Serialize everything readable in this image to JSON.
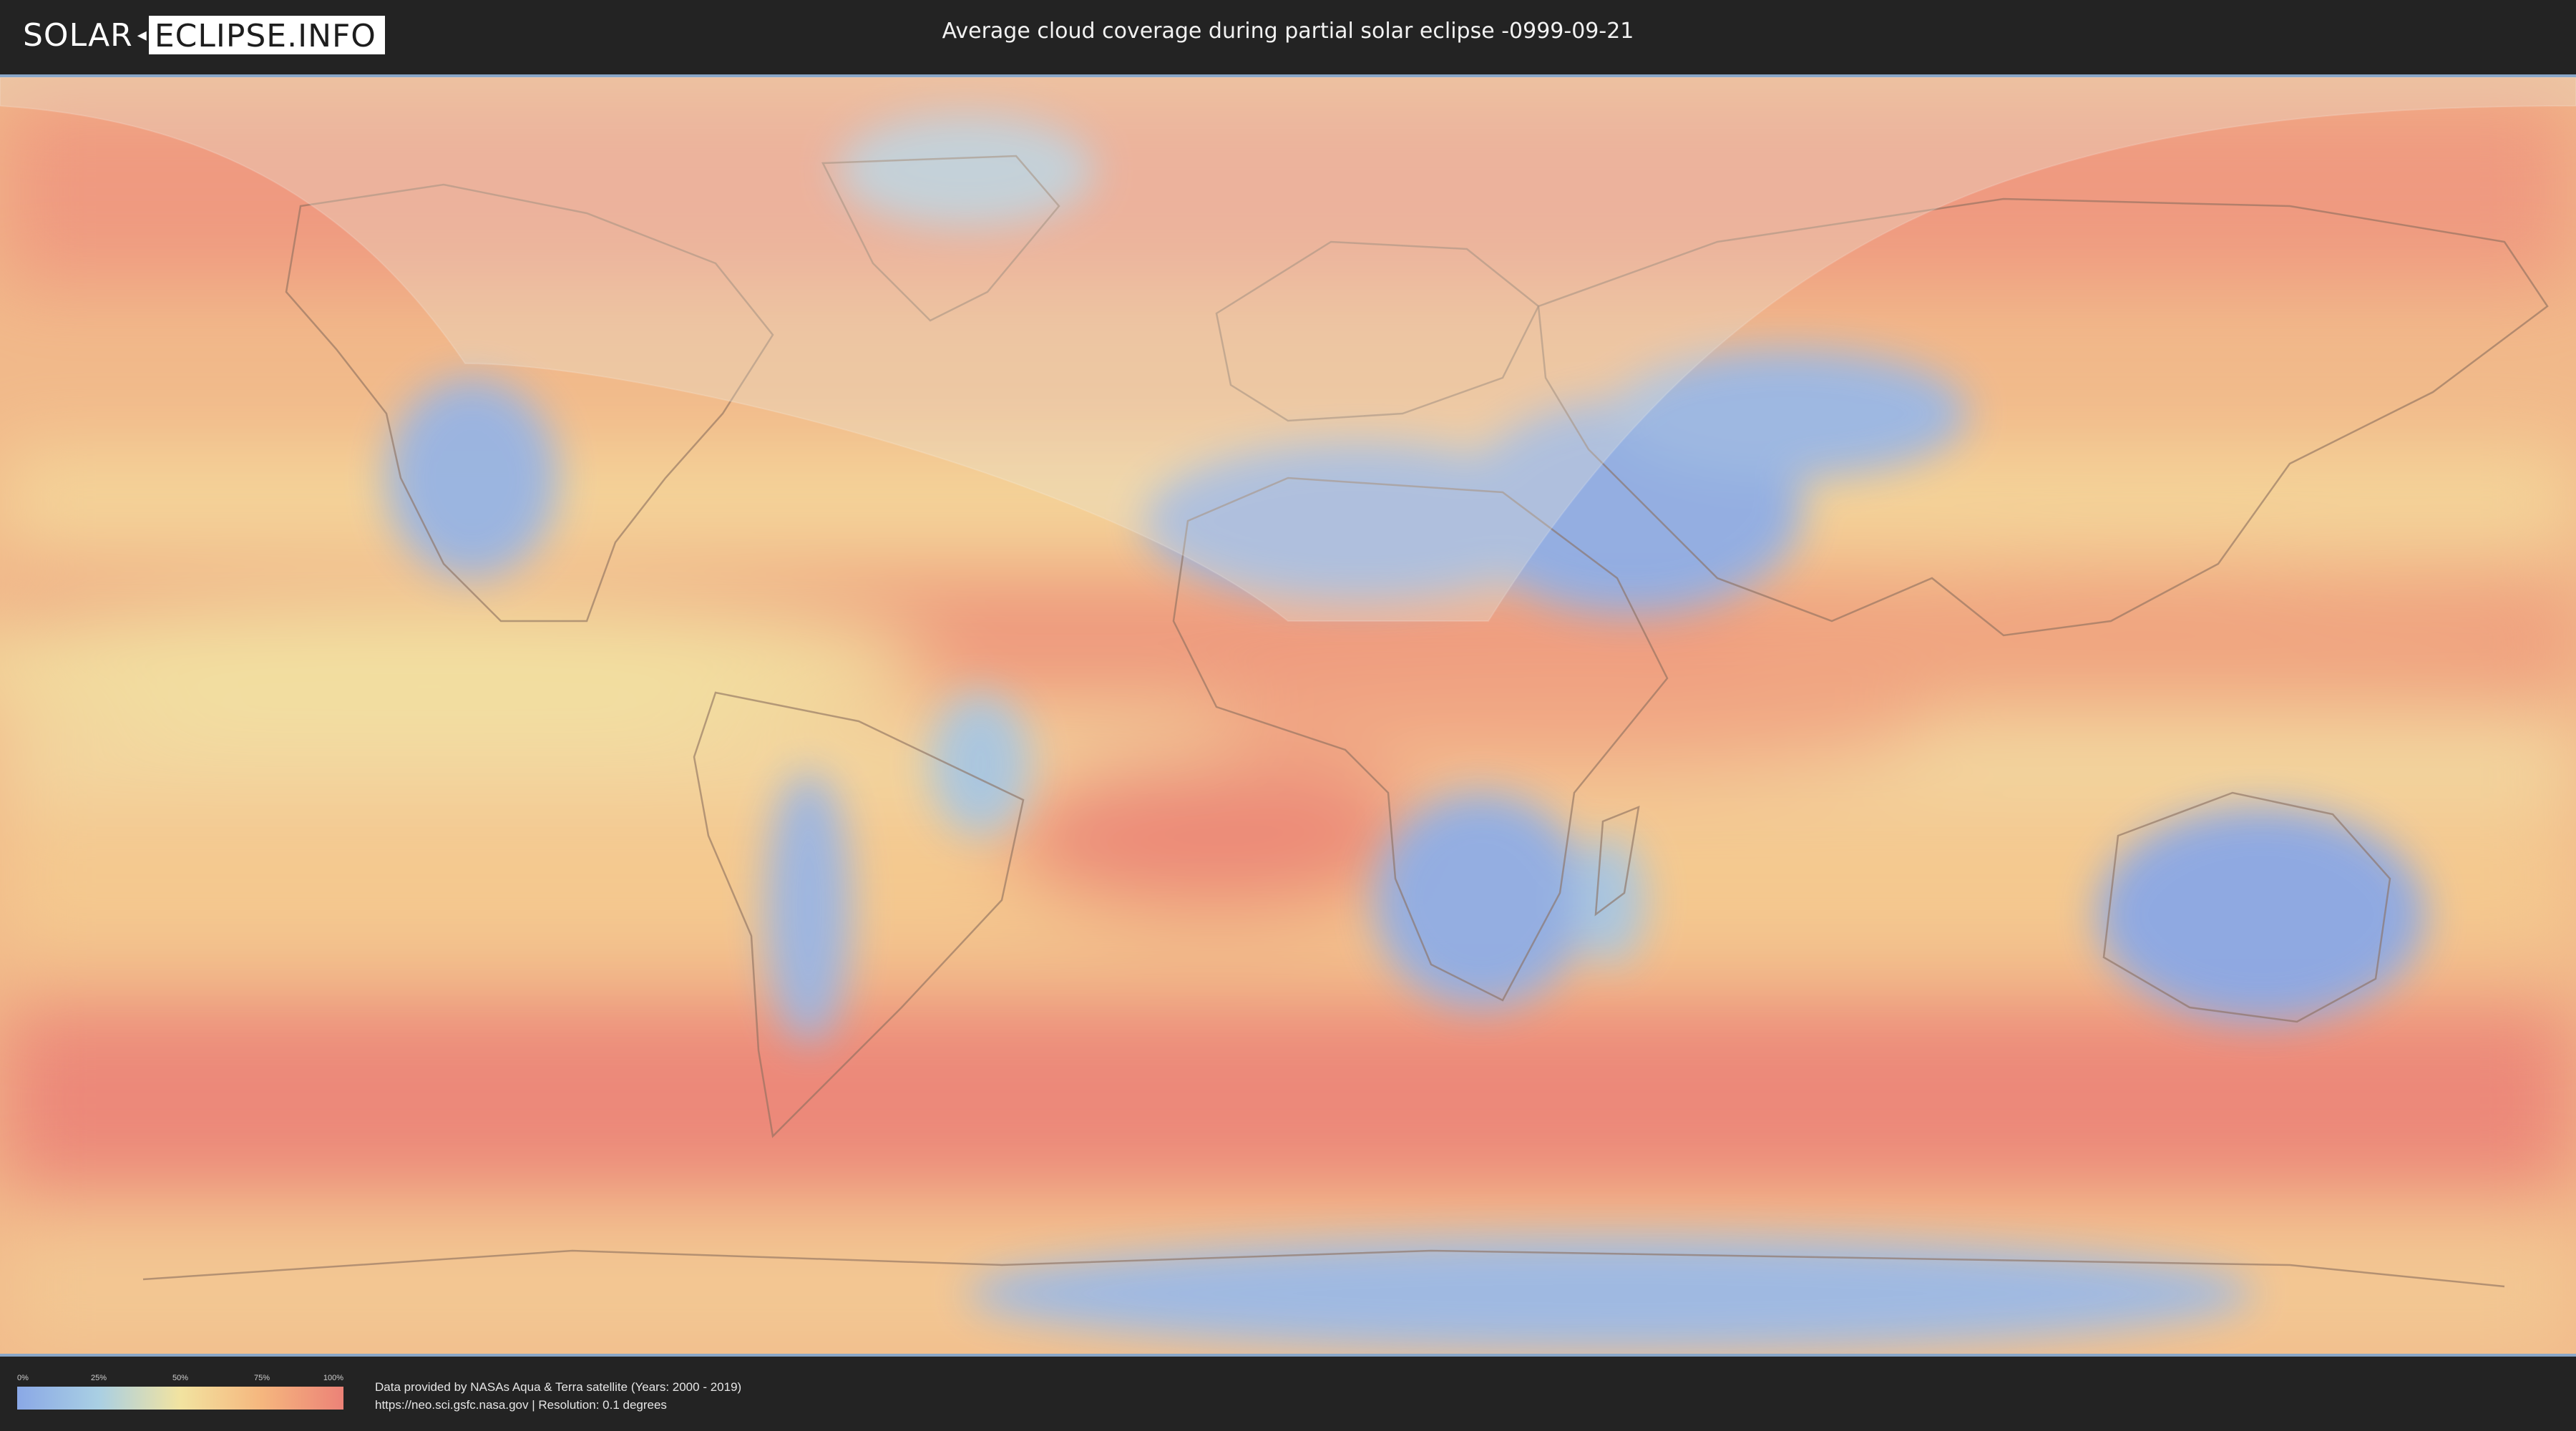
{
  "header": {
    "logo_left": "SOLAR",
    "logo_right": "ECLIPSE.INFO",
    "title": "Average cloud coverage during partial solar eclipse -0999-09-21"
  },
  "legend": {
    "ticks": [
      "0%",
      "25%",
      "50%",
      "75%",
      "100%"
    ]
  },
  "credits": {
    "line1": "Data provided by NASAs Aqua & Terra satellite (Years: 2000 - 2019)",
    "line2": "https://neo.sci.gsfc.nasa.gov | Resolution: 0.1 degrees"
  },
  "map": {
    "colors": {
      "clear": "#8aa8e6",
      "light": "#a9cfe3",
      "medium": "#f2e3a0",
      "heavy": "#f5b67e",
      "overcast": "#ec8277"
    },
    "overlay": "eclipse-visibility-shading"
  }
}
